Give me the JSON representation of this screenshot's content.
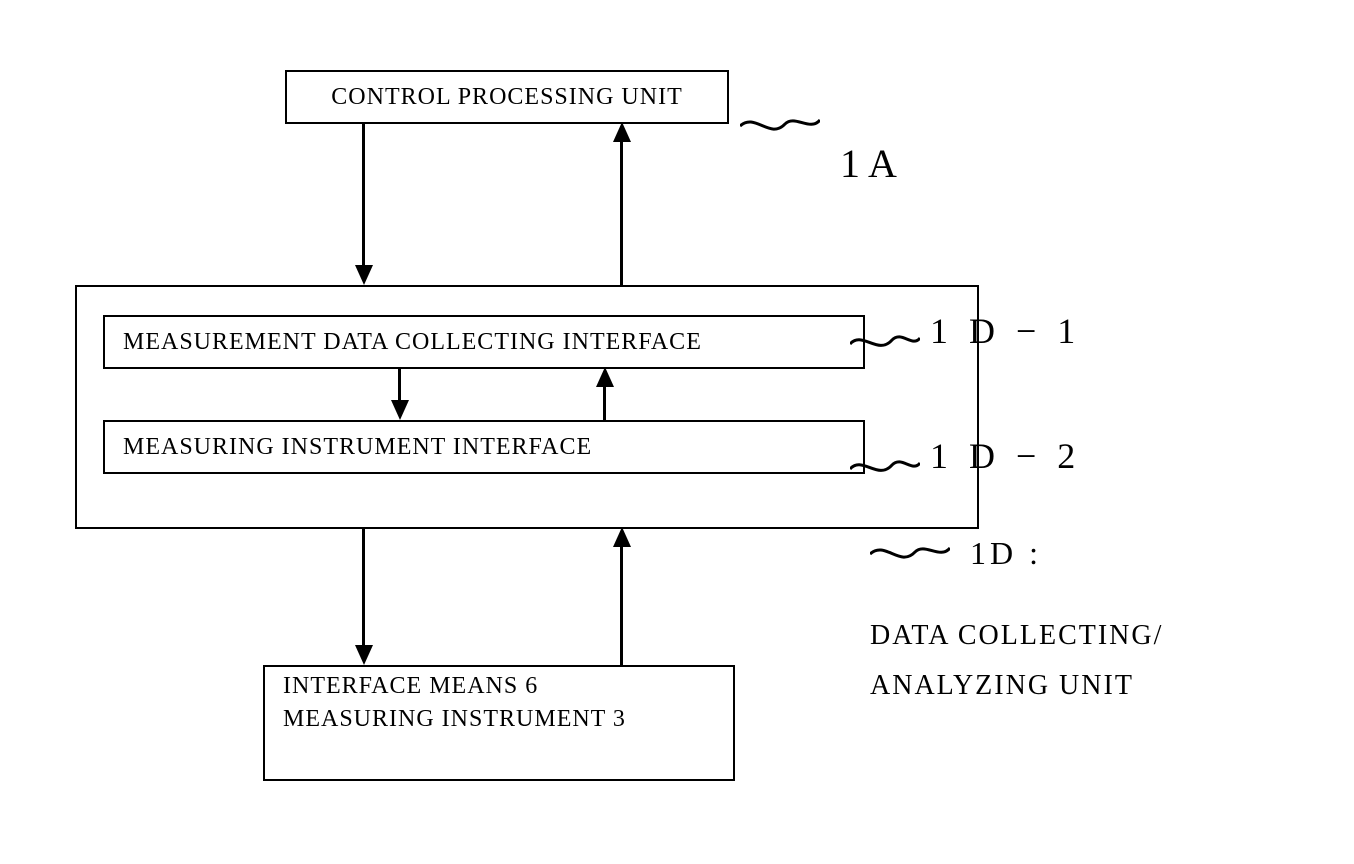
{
  "blocks": {
    "control_processing_unit": "CONTROL PROCESSING UNIT",
    "measurement_data_collecting_interface": "MEASUREMENT DATA COLLECTING INTERFACE",
    "measuring_instrument_interface": "MEASURING INSTRUMENT INTERFACE",
    "interface_means_line1": "INTERFACE MEANS 6",
    "interface_means_line2": "MEASURING INSTRUMENT 3"
  },
  "labels": {
    "ref_1A": "1A",
    "ref_1D_1": "1 D − 1",
    "ref_1D_2": "1 D − 2",
    "ref_1D_prefix": "1D :",
    "ref_1D_line1": "DATA COLLECTING/",
    "ref_1D_line2": "ANALYZING UNIT"
  }
}
